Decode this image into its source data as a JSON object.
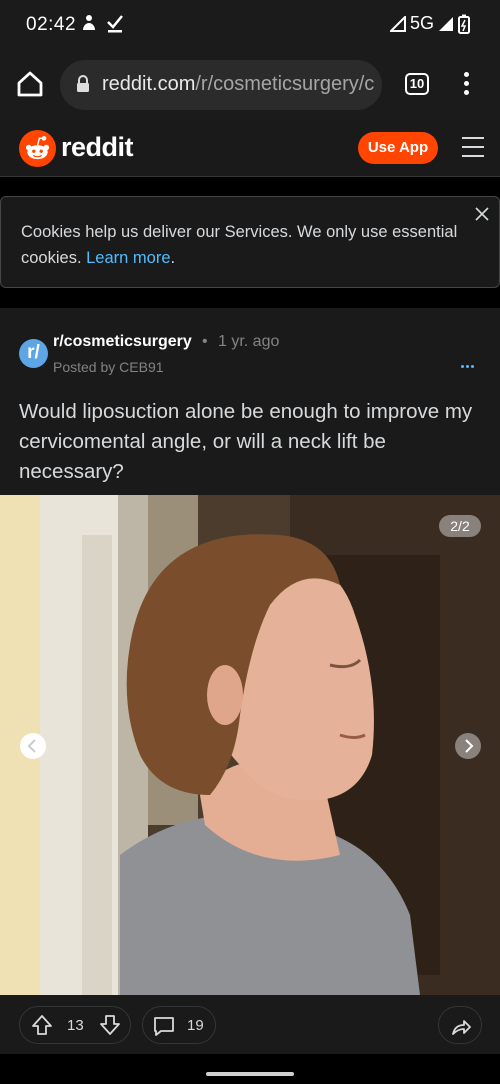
{
  "status_bar": {
    "time": "02:42",
    "network": "5G"
  },
  "browser": {
    "url_main": "reddit.com",
    "url_path": "/r/cosmeticsurgery/c",
    "tab_count": "10"
  },
  "header": {
    "brand": "reddit",
    "use_app_label": "Use App",
    "brand_color": "#ff4500"
  },
  "cookie_banner": {
    "text": "Cookies help us deliver our Services. We only use essential cookies.",
    "link_text": "Learn more",
    "trailing": "."
  },
  "post": {
    "subreddit": "r/cosmeticsurgery",
    "subreddit_icon_text": "r/",
    "age": "1 yr. ago",
    "separator": "•",
    "posted_by": "Posted by CEB91",
    "title": "Would liposuction alone be enough to improve my cervicomental angle, or will a neck lift be necessary?",
    "gallery_position": "2/2",
    "votes": "13",
    "comments": "19"
  }
}
